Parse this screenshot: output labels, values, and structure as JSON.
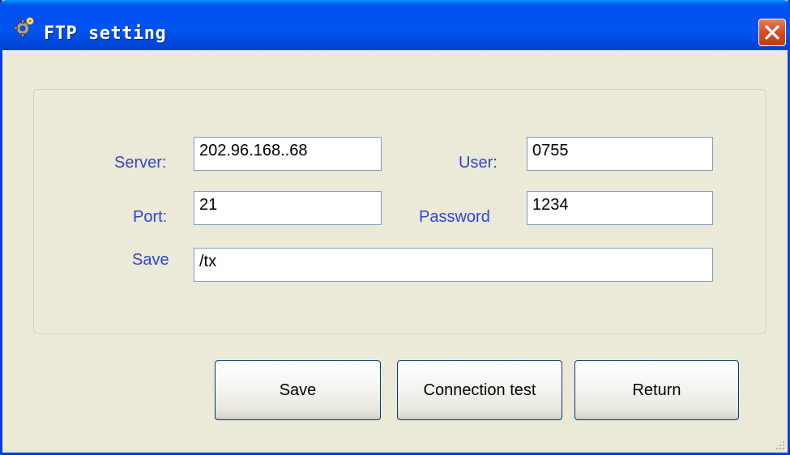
{
  "window": {
    "title": "FTP setting"
  },
  "form": {
    "server_label": "Server:",
    "server_value": "202.96.168..68",
    "user_label": "User:",
    "user_value": "0755",
    "port_label": "Port:",
    "port_value": "21",
    "password_label": "Password",
    "password_value": "1234",
    "save_label": "Save",
    "save_value": "/tx"
  },
  "buttons": {
    "save": "Save",
    "connection_test": "Connection test",
    "return": "Return"
  },
  "icons": {
    "title": "gear-icon",
    "close": "close-icon",
    "resize": "resize-grip-icon"
  },
  "colors": {
    "titlebar": "#0053ee",
    "label_text": "#2b48c6",
    "window_bg": "#ece9d8",
    "close_button": "#d6502b"
  }
}
